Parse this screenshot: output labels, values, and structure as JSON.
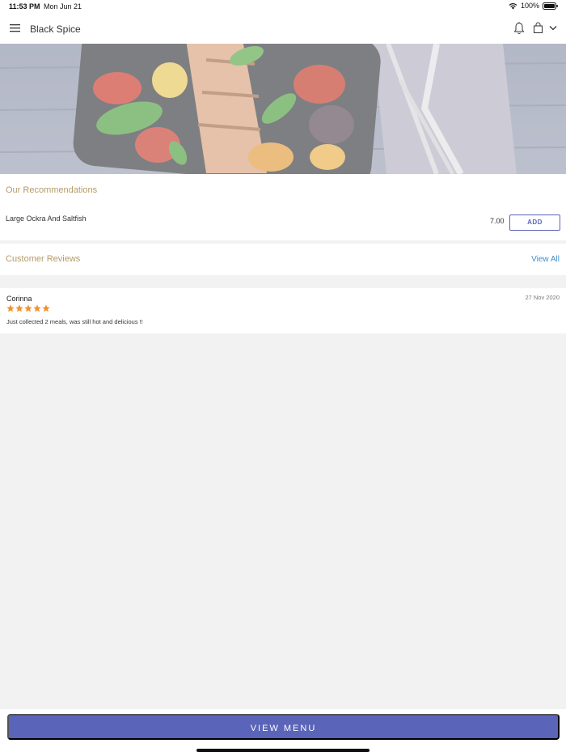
{
  "status": {
    "time": "11:53 PM",
    "date": "Mon Jun 21",
    "battery": "100%"
  },
  "header": {
    "title": "Black Spice",
    "icons": [
      "menu-icon",
      "bell-icon",
      "shopping-bag-icon",
      "chevron-down-icon"
    ]
  },
  "recommendations": {
    "title": "Our Recommendations",
    "items": [
      {
        "name": "Large Ockra And Saltfish",
        "price": "7.00",
        "action": "ADD"
      }
    ]
  },
  "reviews": {
    "title": "Customer Reviews",
    "view_all": "View All",
    "items": [
      {
        "author": "Corinna",
        "date": "27 Nov 2020",
        "rating": 5,
        "text": "Just collected 2 meals, was still hot and delicious !!"
      }
    ]
  },
  "footer": {
    "view_menu": "VIEW MENU"
  },
  "colors": {
    "accent": "#5a64b8",
    "section_title": "#b59a6a",
    "link": "#3f8ec9",
    "star": "#f0922e"
  }
}
